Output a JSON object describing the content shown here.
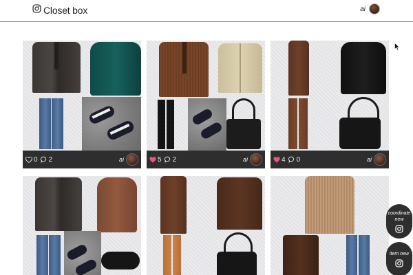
{
  "app": {
    "title": "Closet box",
    "logo_icon": "instagram-icon"
  },
  "user": {
    "name": "ai"
  },
  "cards": [
    {
      "likes": "0",
      "comments": "2",
      "liked": false,
      "user": "ai"
    },
    {
      "likes": "5",
      "comments": "2",
      "liked": true,
      "user": "ai"
    },
    {
      "likes": "4",
      "comments": "0",
      "liked": true,
      "user": "ai"
    }
  ],
  "fab": {
    "coordinate_label": "coordinate new",
    "item_label": "item new"
  },
  "colors": {
    "footer_bg": "#2e2e2e",
    "heart_liked": "#e05c7a"
  }
}
